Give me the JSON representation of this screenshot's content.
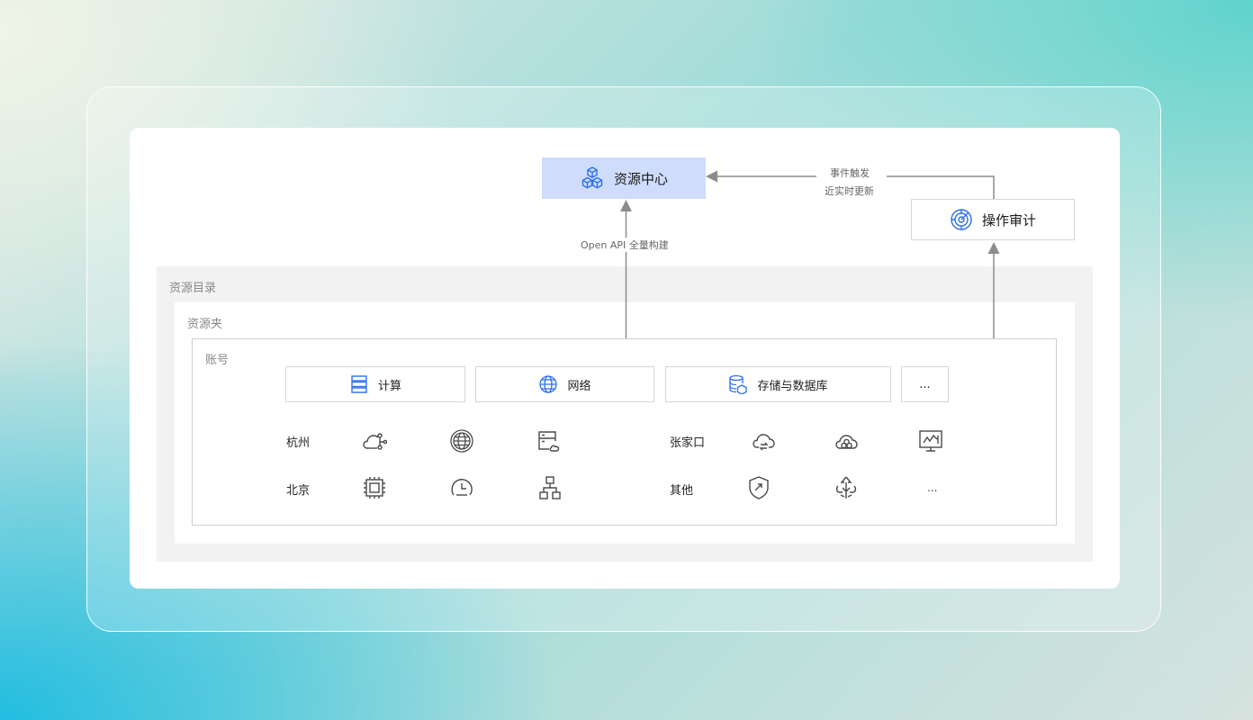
{
  "colors": {
    "accent_blue": "#2a6ff0",
    "center_fill": "#cfdcfb",
    "arrow_gray": "#8c8c8c",
    "icon_gray": "#4a4a4a"
  },
  "nodes": {
    "resource_center": {
      "label": "资源中心",
      "icon": "cubes-icon"
    },
    "operation_audit": {
      "label": "操作审计",
      "icon": "radar-icon"
    }
  },
  "edges": {
    "audit_to_center": {
      "line1": "事件触发",
      "line2": "近实时更新"
    },
    "account_to_center": {
      "label": "Open API 全量构建"
    }
  },
  "containers": {
    "directory": "资源目录",
    "folder": "资源夹",
    "account": "账号"
  },
  "categories": [
    {
      "label": "计算",
      "icon": "server-stack-icon"
    },
    {
      "label": "网络",
      "icon": "globe-network-icon"
    },
    {
      "label": "存储与数据库",
      "icon": "database-icon"
    },
    {
      "label": "..."
    }
  ],
  "regions": [
    "杭州",
    "北京",
    "张家口",
    "其他"
  ],
  "resource_icons": [
    "cloud-network-icon",
    "globe-icon",
    "storage-cloud-icon",
    "cloud-sync-icon",
    "cloud-cluster-icon",
    "monitor-chart-icon",
    "chip-icon",
    "gauge-icon",
    "topology-icon",
    "shield-check-icon",
    "recycle-tree-icon"
  ],
  "more_text": "..."
}
